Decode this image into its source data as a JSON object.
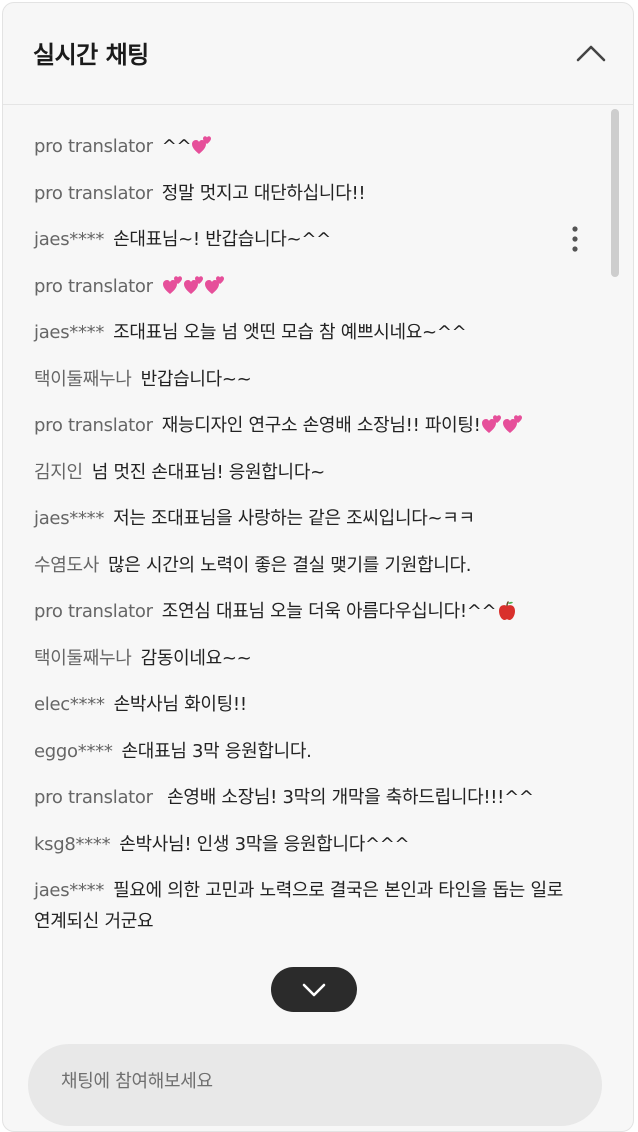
{
  "chat": {
    "title": "실시간 채팅",
    "input_placeholder": "채팅에 참여해보세요"
  },
  "icons": {
    "collapse": "chevron-up-icon",
    "more": "more-vertical-icon",
    "scroll_down": "chevron-down-icon",
    "heart": "two-hearts-icon",
    "apple": "red-apple-icon"
  },
  "colors": {
    "panel_bg": "#f7f7f7",
    "author": "#666666",
    "text": "#222222",
    "heart": "#e64f9a",
    "scroll_button": "#2b2b2b",
    "input_bg": "#e8e8e8"
  },
  "messages": [
    {
      "author": "pro translator",
      "text": "^^",
      "emoji_after": [
        "heart"
      ]
    },
    {
      "author": "pro translator",
      "text": "정말 멋지고 대단하십니다!!"
    },
    {
      "author": "jaes****",
      "text": "손대표님~! 반갑습니다~^^"
    },
    {
      "author": "pro translator",
      "text": "",
      "emoji_after": [
        "heart",
        "heart",
        "heart"
      ]
    },
    {
      "author": "jaes****",
      "text": "조대표님 오늘 넘 앳띤 모습 참 예쁘시네요~^^"
    },
    {
      "author": "택이둘째누나",
      "text": "반갑습니다~~"
    },
    {
      "author": "pro translator",
      "text": "재능디자인 연구소 손영배 소장님!! 파이팅!",
      "emoji_after": [
        "heart",
        "heart"
      ]
    },
    {
      "author": "김지인",
      "text": "넘 멋진 손대표님! 응원합니다~"
    },
    {
      "author": "jaes****",
      "text": "저는 조대표님을 사랑하는 같은 조씨입니다~ㅋㅋ"
    },
    {
      "author": "수염도사",
      "text": "많은 시간의 노력이 좋은 결실 맺기를 기원합니다."
    },
    {
      "author": "pro translator",
      "text": "조연심 대표님 오늘 더욱 아름다우십니다!^^",
      "emoji_after": [
        "apple"
      ]
    },
    {
      "author": "택이둘째누나",
      "text": "감동이네요~~"
    },
    {
      "author": "elec****",
      "text": "손박사님 화이팅!!"
    },
    {
      "author": "eggo****",
      "text": "손대표님 3막 응원합니다."
    },
    {
      "author": "pro translator",
      "text": " 손영배 소장님! 3막의 개막을 축하드립니다!!!^^"
    },
    {
      "author": "ksg8****",
      "text": "손박사님! 인생 3막을 응원합니다^^^"
    },
    {
      "author": "jaes****",
      "text": "필요에 의한 고민과 노력으로 결국은 본인과 타인을 돕는 일로 연계되신 거군요"
    }
  ]
}
